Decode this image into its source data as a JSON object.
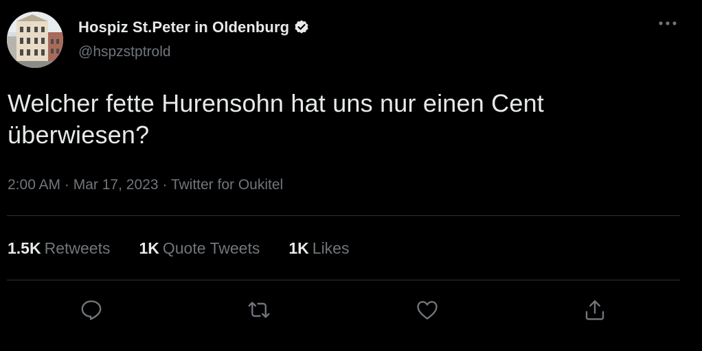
{
  "author": {
    "display_name": "Hospiz St.Peter in Oldenburg",
    "handle": "@hspzstptrold",
    "verified": true,
    "avatar": "building-photo"
  },
  "tweet": {
    "text": "Welcher fette Hurensohn hat uns nur einen Cent überwiesen?",
    "time": "2:00 AM",
    "date": "Mar 17, 2023",
    "separator": "·",
    "source": "Twitter for Oukitel"
  },
  "stats": {
    "retweets": {
      "count": "1.5K",
      "label": "Retweets"
    },
    "quotes": {
      "count": "1K",
      "label": "Quote Tweets"
    },
    "likes": {
      "count": "1K",
      "label": "Likes"
    }
  },
  "actions": {
    "reply_icon": "reply-icon",
    "retweet_icon": "retweet-icon",
    "like_icon": "heart-icon",
    "share_icon": "share-icon"
  },
  "colors": {
    "background": "#000000",
    "primary_text": "#e7e9ea",
    "secondary_text": "#71767b",
    "divider": "#2f3336",
    "icon": "#71767b"
  }
}
